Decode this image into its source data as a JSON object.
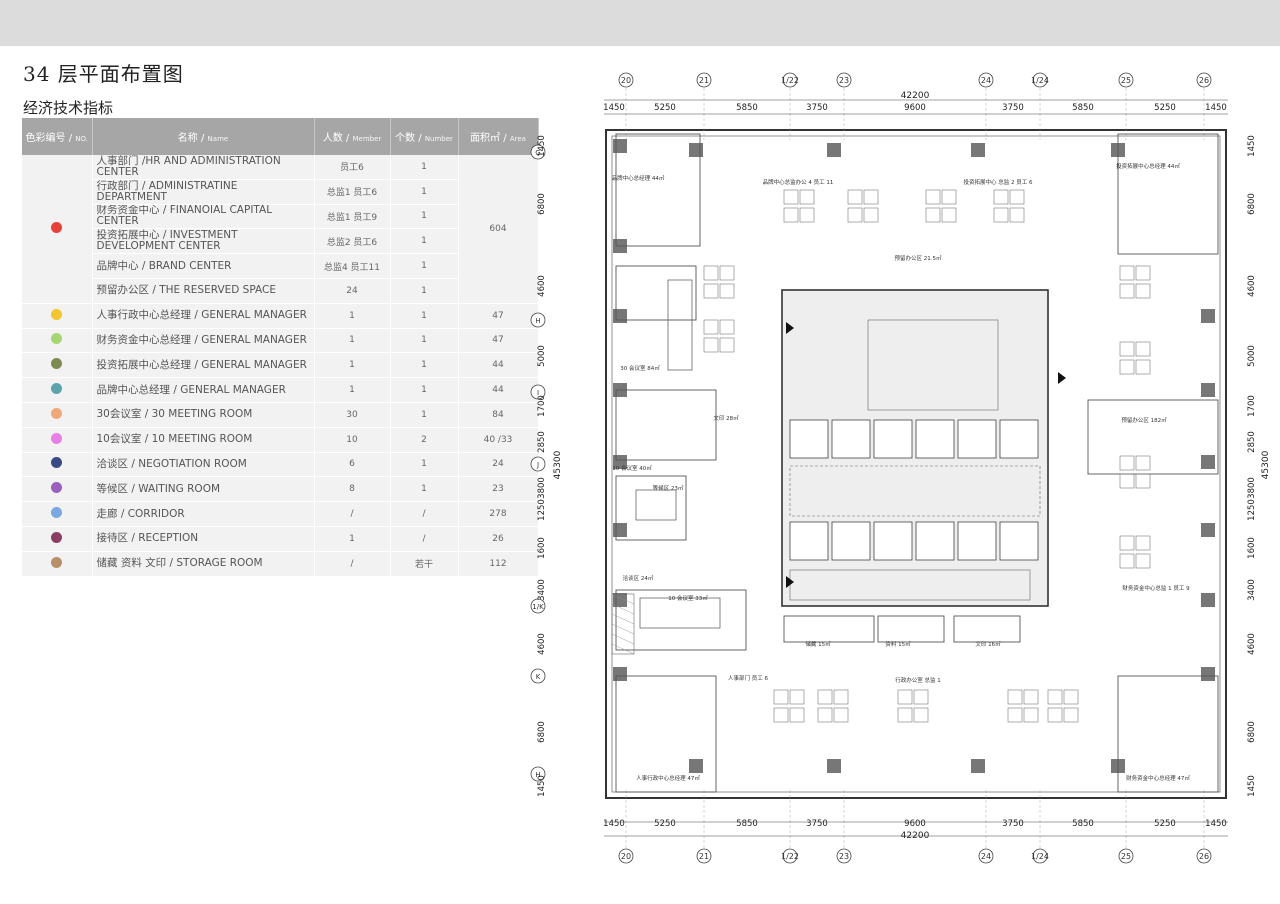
{
  "page": {
    "title": "34 层平面布置图",
    "subtitle": "经济技术指标"
  },
  "table": {
    "headers": {
      "no_cn": "色彩编号 /",
      "no_en": "NO.",
      "name_cn": "名称 /",
      "name_en": "Name",
      "people_cn": "人数 /",
      "people_en": "Member",
      "count_cn": "个数 /",
      "count_en": "Number",
      "area_cn": "面积㎡ /",
      "area_en": "Area"
    },
    "group_color": "#e8413c",
    "group_area": "604",
    "group_rows": [
      {
        "name": "人事部门 /HR AND ADMINISTRATION CENTER",
        "people": "员工6",
        "count": "1"
      },
      {
        "name": "行政部门 / ADMINISTRATINE DEPARTMENT",
        "people": "总监1 员工6",
        "count": "1"
      },
      {
        "name": "财务资金中心 / FINANOIAL CAPITAL CENTER",
        "people": "总监1 员工9",
        "count": "1"
      },
      {
        "name": "投资拓展中心 / INVESTMENT DEVELOPMENT CENTER",
        "people": "总监2 员工6",
        "count": "1"
      },
      {
        "name": "品牌中心 / BRAND CENTER",
        "people": "总监4 员工11",
        "count": "1"
      },
      {
        "name": "预留办公区 / THE RESERVED SPACE",
        "people": "24",
        "count": "1"
      }
    ],
    "rows": [
      {
        "color": "#f3c531",
        "name": "人事行政中心总经理 / GENERAL MANAGER",
        "people": "1",
        "count": "1",
        "area": "47"
      },
      {
        "color": "#a6d672",
        "name": "财务资金中心总经理 / GENERAL MANAGER",
        "people": "1",
        "count": "1",
        "area": "47"
      },
      {
        "color": "#7d8a52",
        "name": "投资拓展中心总经理 / GENERAL MANAGER",
        "people": "1",
        "count": "1",
        "area": "44"
      },
      {
        "color": "#5ca3ad",
        "name": "品牌中心总经理 / GENERAL MANAGER",
        "people": "1",
        "count": "1",
        "area": "44"
      },
      {
        "color": "#f0a878",
        "name": "30会议室 / 30 MEETING ROOM",
        "people": "30",
        "count": "1",
        "area": "84"
      },
      {
        "color": "#e680e6",
        "name": "10会议室 / 10 MEETING ROOM",
        "people": "10",
        "count": "2",
        "area": "40 /33"
      },
      {
        "color": "#3b4a86",
        "name": "洽谈区 / NEGOTIATION ROOM",
        "people": "6",
        "count": "1",
        "area": "24"
      },
      {
        "color": "#9b5fc0",
        "name": "等候区 / WAITING ROOM",
        "people": "8",
        "count": "1",
        "area": "23"
      },
      {
        "color": "#7aa8e0",
        "name": "走廊 / CORRIDOR",
        "people": "/",
        "count": "/",
        "area": "278"
      },
      {
        "color": "#8c3d63",
        "name": "接待区 / RECEPTION",
        "people": "1",
        "count": "/",
        "area": "26"
      },
      {
        "color": "#b8906a",
        "name": "储藏 资料 文印 / STORAGE ROOM",
        "people": "/",
        "count": "若干",
        "area": "112"
      }
    ]
  },
  "plan": {
    "axes_top": [
      "20",
      "21",
      "1/22",
      "23",
      "24",
      "1/24",
      "25",
      "26"
    ],
    "axes_left": [
      "G",
      "H",
      "I",
      "J",
      "1/K",
      "K",
      "H"
    ],
    "total_width": "42200",
    "total_height": "45300",
    "top_dims": [
      "1450",
      "5250",
      "5850",
      "3750",
      "9600",
      "3750",
      "5850",
      "5250",
      "1450"
    ],
    "side_dims": [
      "1450",
      "6800",
      "4600",
      "5000",
      "1700",
      "2850",
      "3800",
      "1250",
      "1600",
      "3400",
      "4600",
      "6800",
      "1450"
    ],
    "right_dims": [
      "1450",
      "6800",
      "4600",
      "5000",
      "1700",
      "2850",
      "3800",
      "1250",
      "1600",
      "3400",
      "4600",
      "6800",
      "1450"
    ],
    "labels": [
      "品牌中心总经理 44㎡",
      "品牌中心总监办公 4 员工 11",
      "投资拓展中心 总监 2 员工 6",
      "投资拓展中心总经理 44㎡",
      "预留办公区 21.5㎡",
      "30 会议室 84㎡",
      "10 会议室 40㎡",
      "文印 28㎡",
      "等候区 23㎡",
      "洽谈区 24㎡",
      "10 会议室 33㎡",
      "预留办公区 182㎡",
      "财务资金中心总监 1 员工 9",
      "人事部门 员工 6",
      "行政办公室 总监 1",
      "人事行政中心总经理 47㎡",
      "财务资金中心总经理 47㎡",
      "储藏 15㎡",
      "资料 15㎡",
      "文印 16㎡"
    ]
  }
}
